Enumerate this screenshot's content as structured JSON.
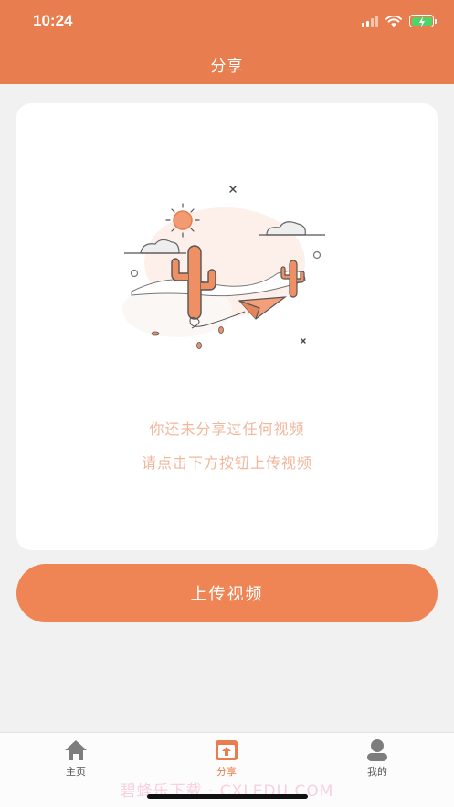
{
  "status_bar": {
    "time": "10:24"
  },
  "header": {
    "title": "分享"
  },
  "empty_state": {
    "line1": "你还未分享过任何视频",
    "line2": "请点击下方按钮上传视频"
  },
  "upload_button": {
    "label": "上传视频"
  },
  "tabbar": {
    "items": [
      {
        "label": "主页",
        "icon": "home-icon",
        "active": false
      },
      {
        "label": "分享",
        "icon": "share-upload-icon",
        "active": true
      },
      {
        "label": "我的",
        "icon": "person-icon",
        "active": false
      }
    ]
  },
  "watermark": "碧蜂乐下载 · CXLEDU.COM",
  "colors": {
    "accent": "#e87d4f",
    "button": "#ef8555",
    "empty_text": "#f0b79c",
    "battery": "#52d36a"
  }
}
